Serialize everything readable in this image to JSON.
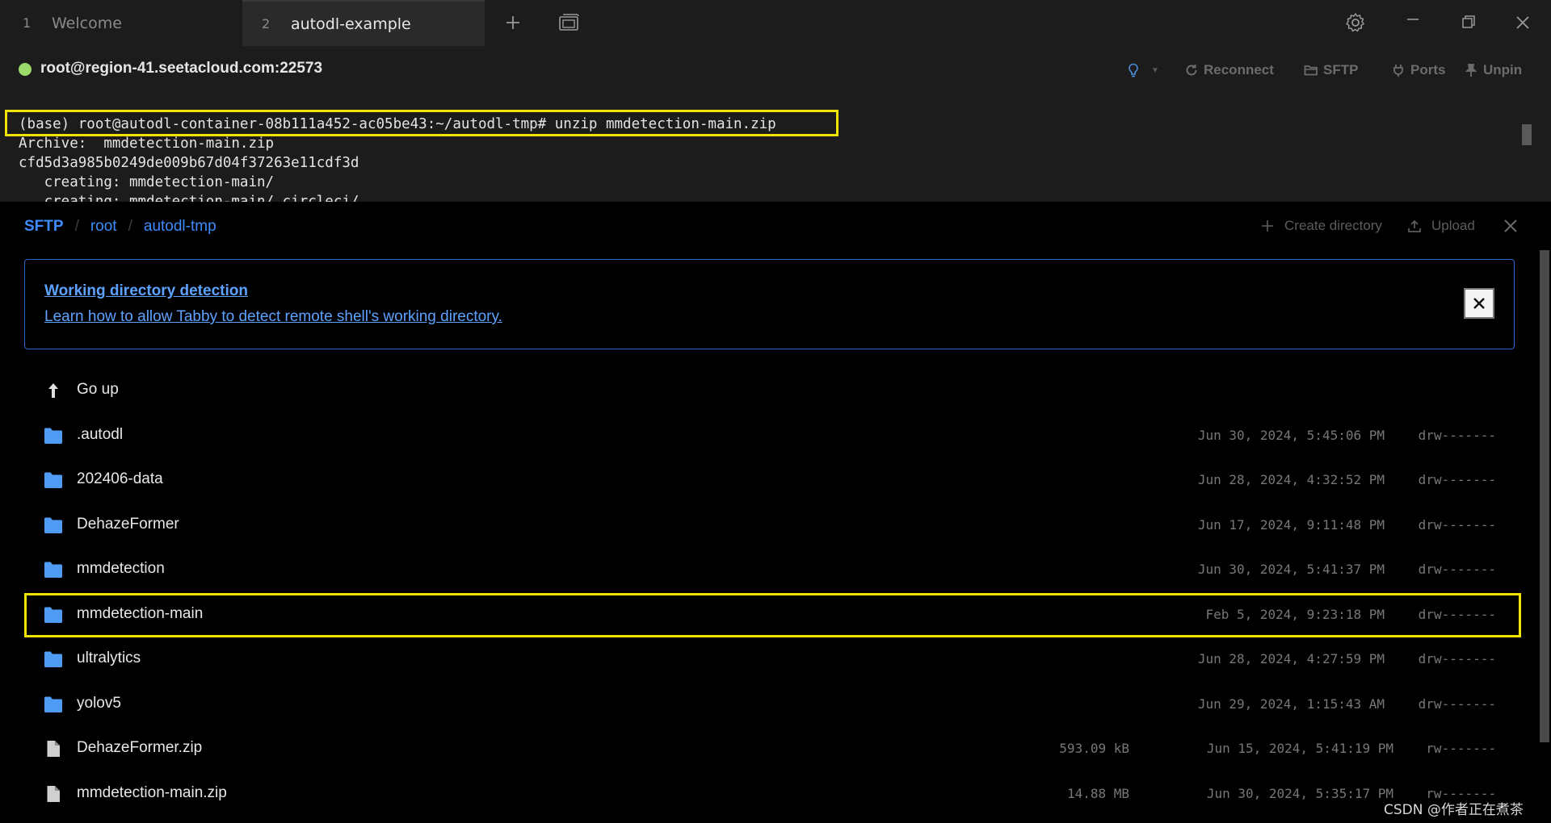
{
  "tabs": [
    {
      "number": "1",
      "label": "Welcome",
      "active": false
    },
    {
      "number": "2",
      "label": "autodl-example",
      "active": true
    }
  ],
  "tab_icons": {
    "new_tab": "plus-icon",
    "window": "window-icon",
    "settings": "gear-icon",
    "minimize": "minimize-icon",
    "restore": "restore-icon",
    "close": "close-icon"
  },
  "connection": {
    "status_color": "#9bd96a",
    "title": "root@region-41.seetacloud.com:22573",
    "buttons": {
      "reconnect": "Reconnect",
      "sftp": "SFTP",
      "ports": "Ports",
      "unpin": "Unpin"
    }
  },
  "terminal": {
    "lines": [
      "(base) root@autodl-container-08b111a452-ac05be43:~/autodl-tmp# unzip mmdetection-main.zip",
      "Archive:  mmdetection-main.zip",
      "cfd5d3a985b0249de009b67d04f37263e11cdf3d",
      "   creating: mmdetection-main/",
      "   creating: mmdetection-main/.circleci/"
    ],
    "highlight_color": "#f0e500"
  },
  "sftp": {
    "breadcrumb": [
      "SFTP",
      "root",
      "autodl-tmp"
    ],
    "create_directory": "Create directory",
    "upload": "Upload",
    "notice": {
      "title": "Working directory detection",
      "link": "Learn how to allow Tabby to detect remote shell's working directory."
    },
    "go_up": "Go up",
    "files": [
      {
        "name": ".autodl",
        "type": "folder",
        "size": "",
        "date": "Jun 30, 2024, 5:45:06 PM",
        "mode": "drw-------"
      },
      {
        "name": "202406-data",
        "type": "folder",
        "size": "",
        "date": "Jun 28, 2024, 4:32:52 PM",
        "mode": "drw-------"
      },
      {
        "name": "DehazeFormer",
        "type": "folder",
        "size": "",
        "date": "Jun 17, 2024, 9:11:48 PM",
        "mode": "drw-------"
      },
      {
        "name": "mmdetection",
        "type": "folder",
        "size": "",
        "date": "Jun 30, 2024, 5:41:37 PM",
        "mode": "drw-------"
      },
      {
        "name": "mmdetection-main",
        "type": "folder",
        "size": "",
        "date": "Feb 5, 2024, 9:23:18 PM",
        "mode": "drw-------",
        "highlighted": true
      },
      {
        "name": "ultralytics",
        "type": "folder",
        "size": "",
        "date": "Jun 28, 2024, 4:27:59 PM",
        "mode": "drw-------"
      },
      {
        "name": "yolov5",
        "type": "folder",
        "size": "",
        "date": "Jun 29, 2024, 1:15:43 AM",
        "mode": "drw-------"
      },
      {
        "name": "DehazeFormer.zip",
        "type": "file",
        "size": "593.09 kB",
        "date": "Jun 15, 2024, 5:41:19 PM",
        "mode": "rw-------"
      },
      {
        "name": "mmdetection-main.zip",
        "type": "file",
        "size": "14.88 MB",
        "date": "Jun 30, 2024, 5:35:17 PM",
        "mode": "rw-------"
      }
    ],
    "folder_color": "#4f9cf5",
    "file_color": "#d0d0d0"
  },
  "watermark": "CSDN @作者正在煮茶"
}
